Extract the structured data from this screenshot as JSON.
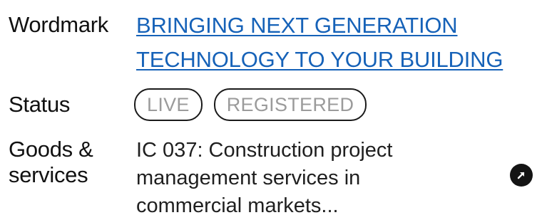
{
  "wordmark": {
    "label": "Wordmark",
    "value": "BRINGING NEXT GENERATION TECHNOLOGY TO YOUR BUILDING"
  },
  "status": {
    "label": "Status",
    "badges": [
      "LIVE",
      "REGISTERED"
    ]
  },
  "goods_services": {
    "label_line1": "Goods &",
    "label_line2": "services",
    "value": "IC 037: Construction project management services in commercial markets..."
  },
  "icons": {
    "open_link": "arrow-up-right-icon"
  }
}
